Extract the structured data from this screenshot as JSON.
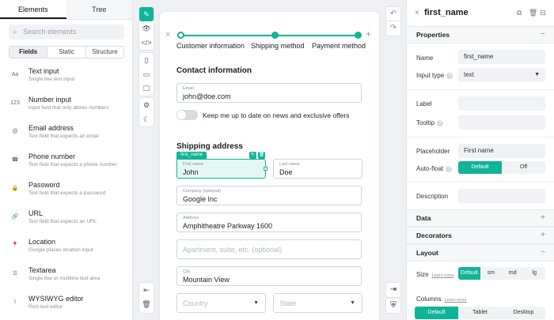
{
  "left": {
    "tabs": [
      "Elements",
      "Tree"
    ],
    "search_placeholder": "Search elements",
    "segments": [
      "Fields",
      "Static",
      "Structure"
    ],
    "elements": [
      {
        "icon": "Aa",
        "icon_name": "text-input-icon",
        "title": "Text input",
        "desc": "Single line text input"
      },
      {
        "icon": "123",
        "icon_name": "number-input-icon",
        "title": "Number input",
        "desc": "Input field that only allows numbers"
      },
      {
        "icon": "@",
        "icon_name": "at-sign-icon",
        "title": "Email address",
        "desc": "Text field that expects an email"
      },
      {
        "icon": "☎",
        "icon_name": "phone-icon",
        "title": "Phone number",
        "desc": "Text field that expects a phone number"
      },
      {
        "icon": "🔒",
        "icon_name": "lock-icon",
        "title": "Password",
        "desc": "Text field that expects a password"
      },
      {
        "icon": "🔗",
        "icon_name": "link-icon",
        "title": "URL",
        "desc": "Text field that expects an URL"
      },
      {
        "icon": "📍",
        "icon_name": "location-pin-icon",
        "title": "Location",
        "desc": "Google places location input"
      },
      {
        "icon": "☰",
        "icon_name": "textarea-icon",
        "title": "Textarea",
        "desc": "Single line or multiline text area"
      },
      {
        "icon": "I",
        "icon_name": "italic-editor-icon",
        "title": "WYSIWYG editor",
        "desc": "Rich text editor"
      }
    ]
  },
  "toolbar": {
    "top": [
      {
        "icon": "✎",
        "name": "edit-mode-icon",
        "on": true
      },
      {
        "icon": "👁",
        "name": "preview-icon",
        "on": false
      },
      {
        "icon": "</>",
        "name": "code-icon",
        "on": false
      }
    ],
    "devices": [
      {
        "icon": "▯",
        "name": "mobile-icon"
      },
      {
        "icon": "▭",
        "name": "tablet-icon"
      },
      {
        "icon": "🖵",
        "name": "desktop-icon"
      }
    ],
    "extra": [
      {
        "icon": "⚙",
        "name": "settings-icon"
      },
      {
        "icon": "☾",
        "name": "dark-mode-icon"
      }
    ]
  },
  "steps": [
    "Customer information",
    "Shipping method",
    "Payment method"
  ],
  "form": {
    "contact_title": "Contact information",
    "email_label": "Email",
    "email_value": "john@doe.com",
    "newsletter_label": "Keep me up to date on news and exclusive offers",
    "shipping_title": "Shipping address",
    "selected_tag": "first_name",
    "first_name_label": "First name",
    "first_name_value": "John",
    "last_name_label": "Last name",
    "last_name_value": "Doe",
    "company_label": "Company (optional)",
    "company_value": "Google Inc",
    "address_label": "Address",
    "address_value": "Amphitheatre Parkway 1600",
    "address2_placeholder": "Apartment, suite, etc. (optional)",
    "city_label": "City",
    "city_value": "Mountain View",
    "country_placeholder": "Country",
    "state_placeholder": "State"
  },
  "right": {
    "title": "first_name",
    "properties_title": "Properties",
    "name_label": "Name",
    "name_value": "first_name",
    "input_type_label": "Input type",
    "input_type_value": "text",
    "label_label": "Label",
    "tooltip_label": "Tooltip",
    "placeholder_label": "Placeholder",
    "placeholder_value": "First name",
    "autofloat_label": "Auto-float",
    "autofloat_options": [
      "Default",
      "Off"
    ],
    "description_label": "Description",
    "data_title": "Data",
    "decorators_title": "Decorators",
    "layout_title": "Layout",
    "size_label": "Size",
    "learn_more": "Learn more",
    "size_options": [
      "Default",
      "sm",
      "md",
      "lg"
    ],
    "columns_label": "Columns",
    "columns_options": [
      "Default",
      "Tablet",
      "Desktop"
    ]
  },
  "colors": {
    "accent": "#10b496"
  }
}
